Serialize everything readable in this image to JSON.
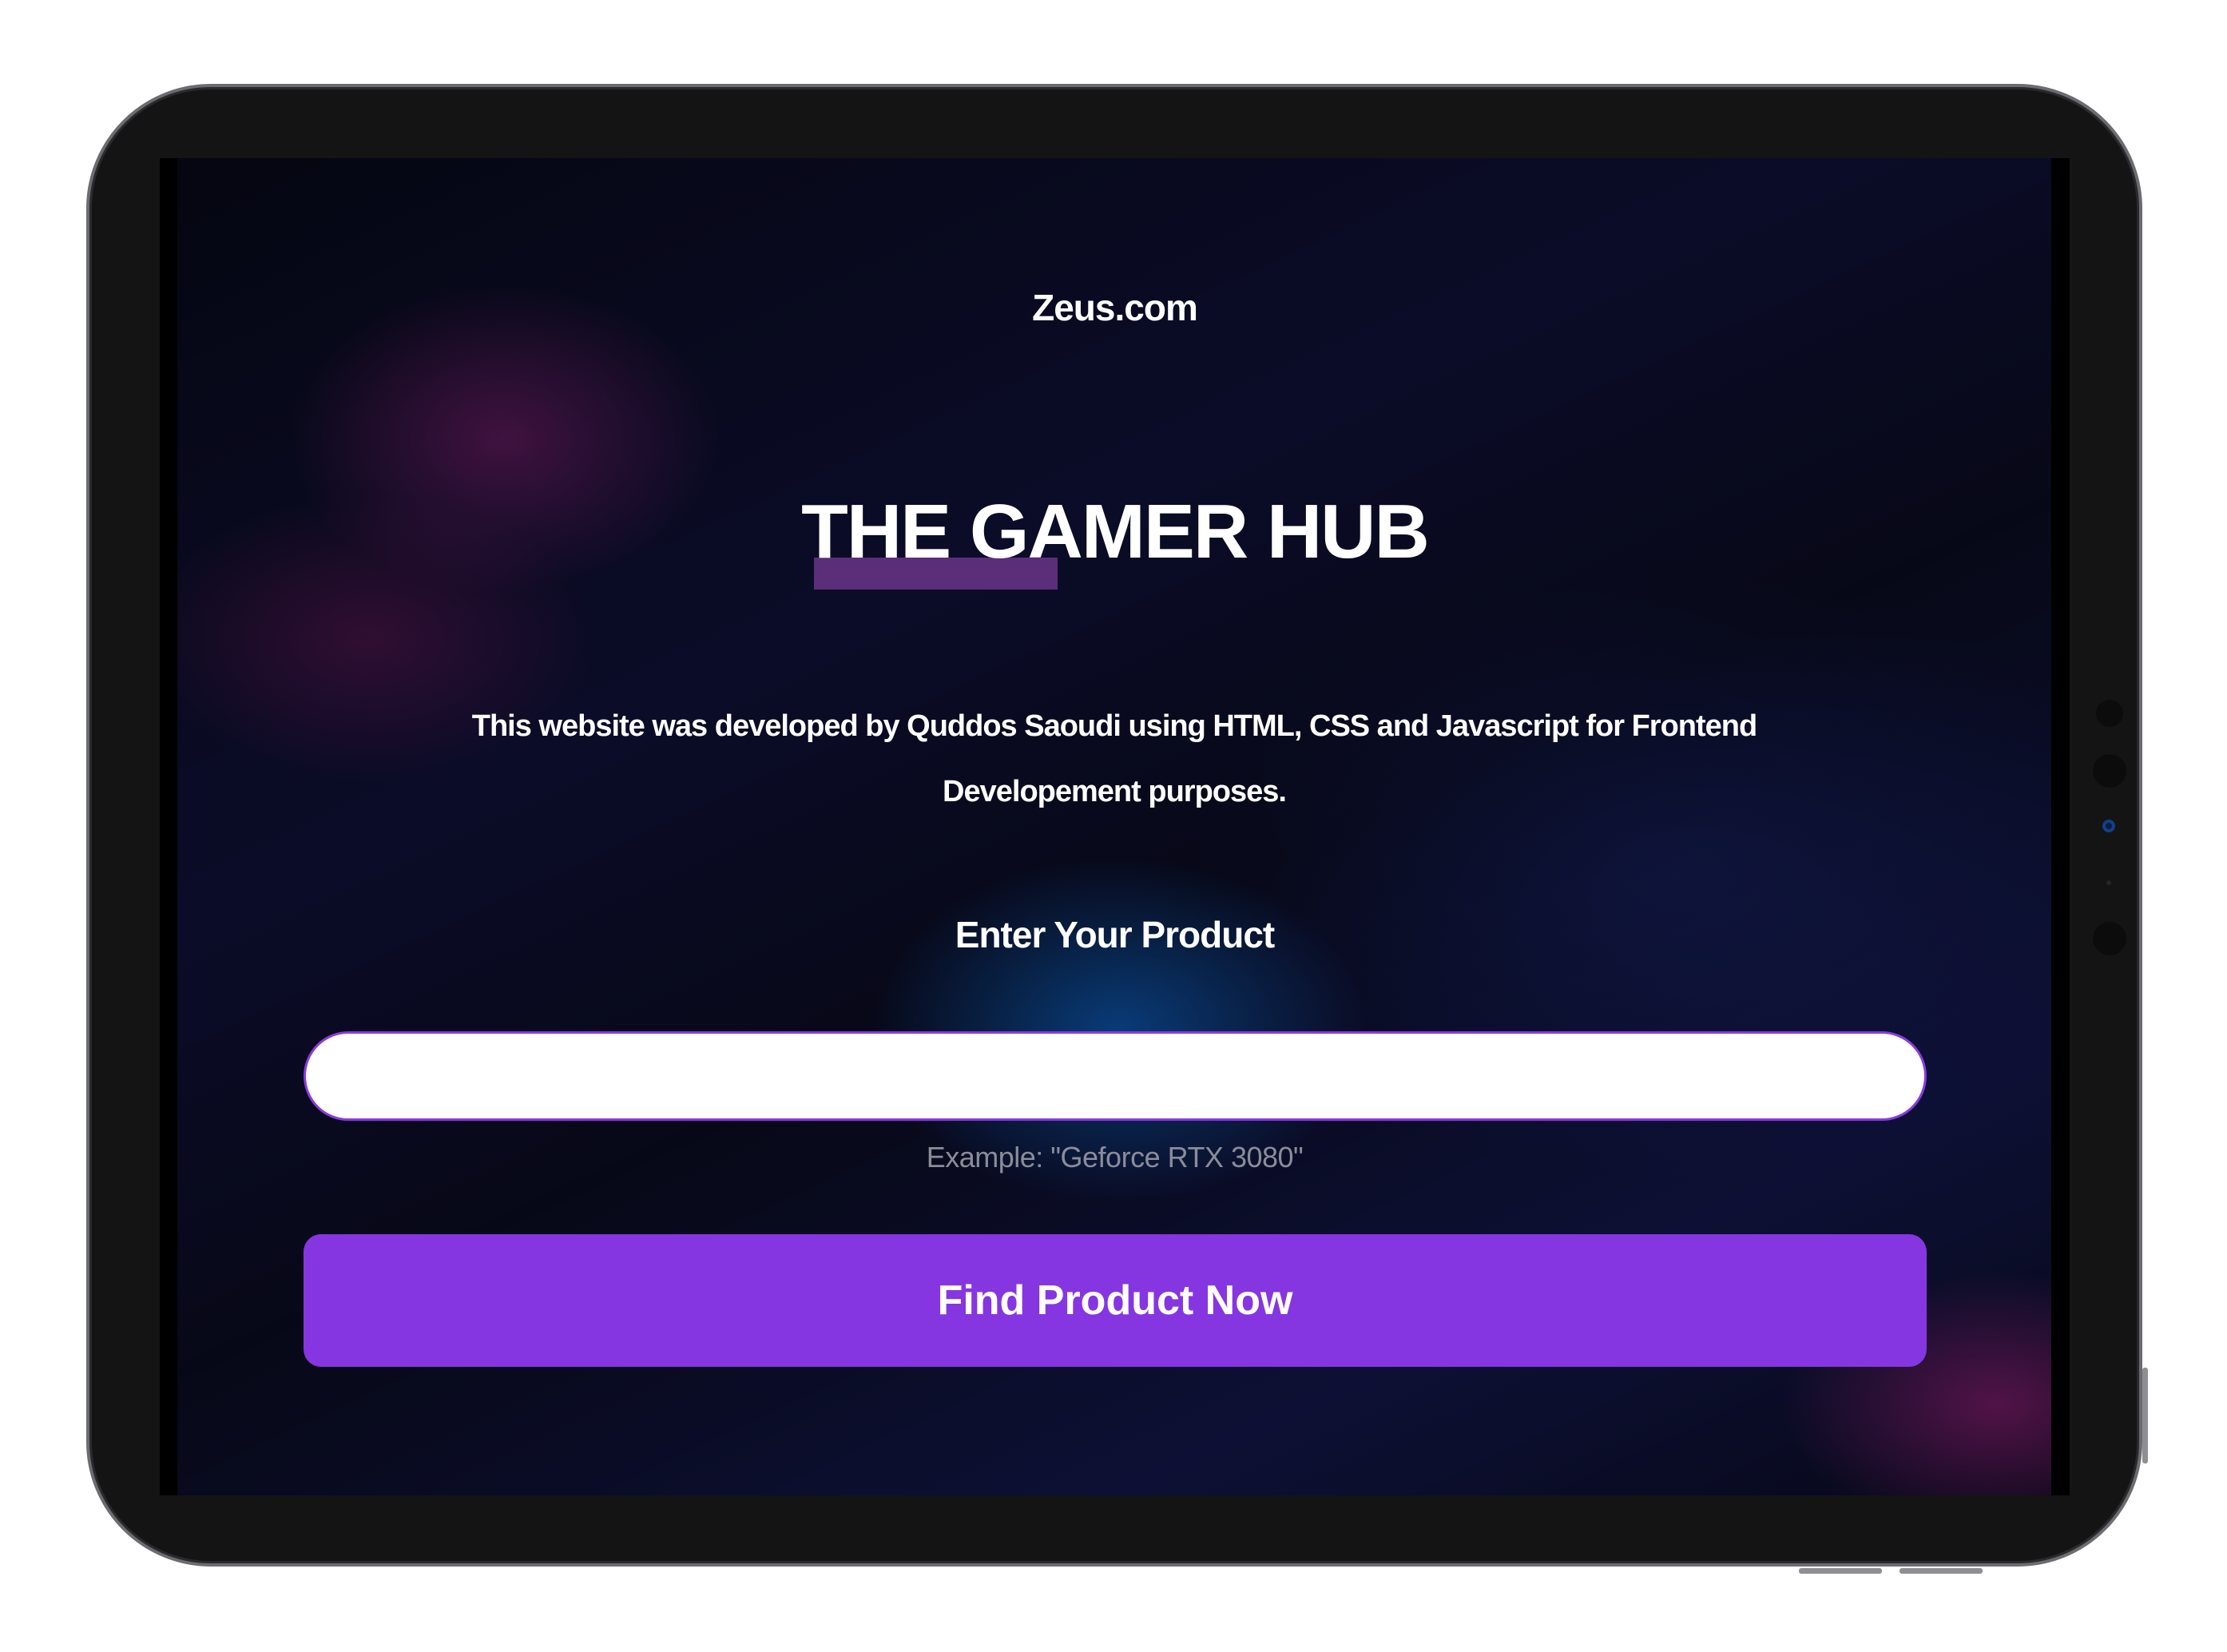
{
  "site": {
    "brand": "Zeus.com",
    "title": "THE GAMER HUB",
    "description": "This website was developed by Quddos Saoudi using HTML, CSS and Javascript for Frontend Developement purposes."
  },
  "search": {
    "label": "Enter Your Product",
    "value": "",
    "hint": "Example: \"Geforce RTX 3080\"",
    "button_label": "Find Product Now"
  },
  "colors": {
    "accent": "#8636e0",
    "title_highlight": "#5a2e78",
    "background": "#0b0c28"
  }
}
